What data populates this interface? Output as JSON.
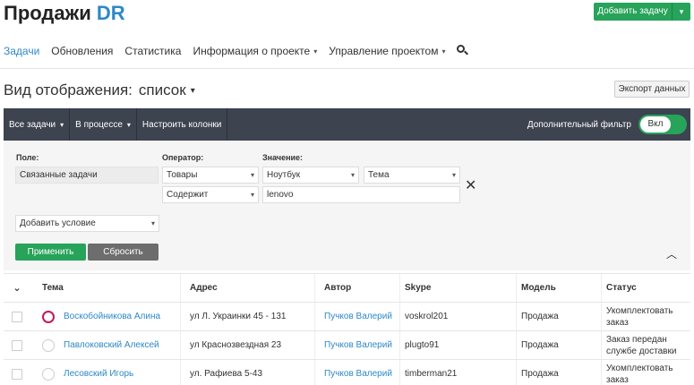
{
  "header": {
    "title_main": "Продажи",
    "title_accent": "DR",
    "add_task_label": "Добавить задачу"
  },
  "nav": {
    "items": [
      {
        "label": "Задачи",
        "active": true,
        "dropdown": false
      },
      {
        "label": "Обновления",
        "active": false,
        "dropdown": false
      },
      {
        "label": "Статистика",
        "active": false,
        "dropdown": false
      },
      {
        "label": "Информация о проекте",
        "active": false,
        "dropdown": true
      },
      {
        "label": "Управление проектом",
        "active": false,
        "dropdown": true
      }
    ],
    "search_icon": "search-icon"
  },
  "view": {
    "label": "Вид отображения:",
    "mode": "список",
    "export_label": "Экспорт данных"
  },
  "toolbar": {
    "all_tasks": "Все задачи",
    "in_progress": "В процессе",
    "columns": "Настроить колонки",
    "extra_filter": "Дополнительный фильтр",
    "toggle_label": "Вкл"
  },
  "filter": {
    "field_label": "Поле:",
    "operator_label": "Оператор:",
    "value_label": "Значение:",
    "field_value": "Связанные задачи",
    "operator_1": "Товары",
    "operator_2": "Содержит",
    "value_1": "Ноутбук",
    "value_2": "Тема",
    "value_3": "lenovo",
    "add_condition": "Добавить условие",
    "apply": "Применить",
    "reset": "Сбросить",
    "close_glyph": "✕",
    "collapse_glyph": "︿"
  },
  "table": {
    "headers": [
      "Тема",
      "Адрес",
      "Автор",
      "Skype",
      "Модель",
      "Статус"
    ],
    "rows": [
      {
        "topic": "Воскобойникова Алина",
        "address": "ул Л. Украинки 45 - 131",
        "author": "Пучков Валерий",
        "skype": "voskrol201",
        "model": "Продажа",
        "status": "Укомплектовать заказ",
        "highlight": true
      },
      {
        "topic": "Павлоковский Алексей",
        "address": "ул Краснозвездная 23",
        "author": "Пучков Валерий",
        "skype": "plugto91",
        "model": "Продажа",
        "status": "Заказ передан службе доставки",
        "highlight": false
      },
      {
        "topic": "Лесовский Игорь",
        "address": "ул. Рафиева 5-43",
        "author": "Пучков Валерий",
        "skype": "timberman21",
        "model": "Продажа",
        "status": "Укомплектовать заказ",
        "highlight": false
      }
    ]
  },
  "colors": {
    "accent": "#2e88c7",
    "green": "#27a35a",
    "toolbar": "#3d434f",
    "highlight": "#c2185b"
  }
}
